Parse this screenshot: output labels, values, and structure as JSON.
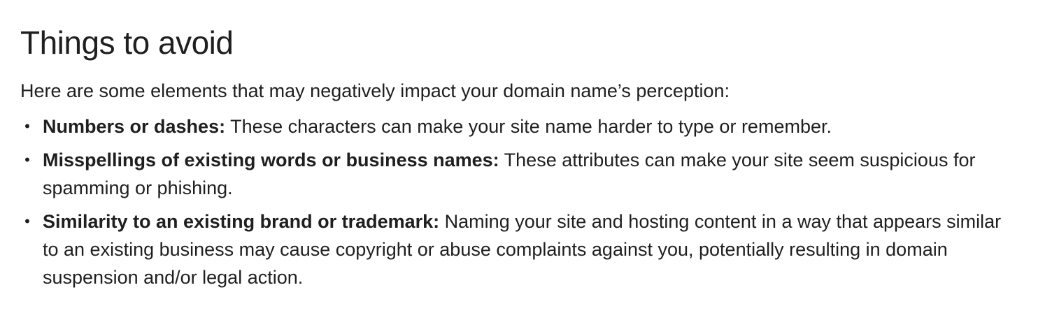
{
  "section": {
    "title": "Things to avoid",
    "intro": "Here are some elements that may negatively impact your domain name’s perception:",
    "items": [
      {
        "term": "Numbers or dashes:",
        "description": "These characters can make your site name harder to type or remember."
      },
      {
        "term": "Misspellings of existing words or business names:",
        "description": "These attributes can make your site seem suspicious for spamming or phishing."
      },
      {
        "term": "Similarity to an existing brand or trademark:",
        "description": "Naming your site and hosting content in a way that appears similar to an existing business may cause copyright or abuse complaints against you, potentially resulting in domain suspension and/or legal action."
      }
    ]
  }
}
